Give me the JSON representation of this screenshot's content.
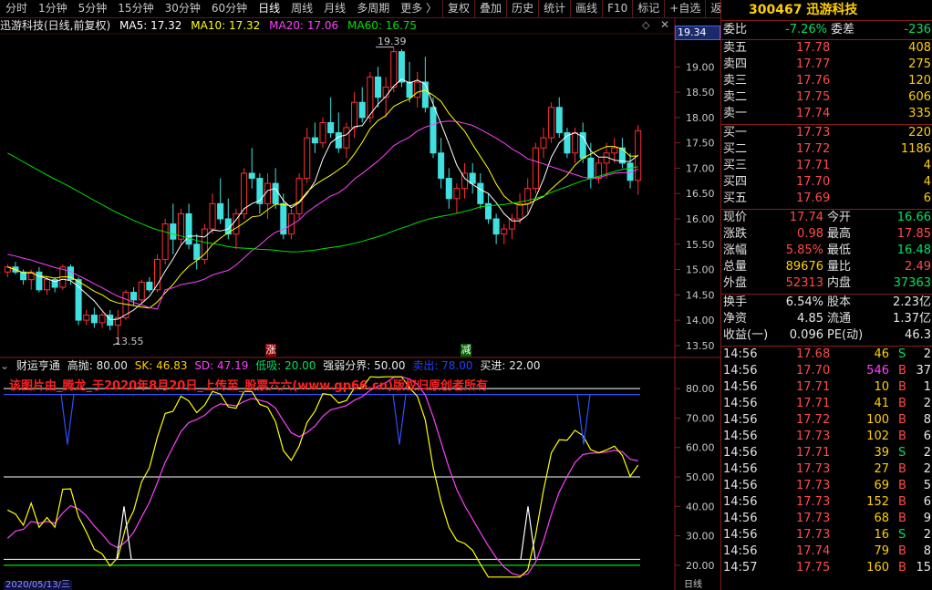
{
  "toolbar": {
    "items": [
      "分时",
      "1分钟",
      "5分钟",
      "15分钟",
      "30分钟",
      "60分钟",
      "日线",
      "周线",
      "月线",
      "多周期",
      "更多 〉"
    ],
    "active": "日线",
    "right_items": [
      "复权",
      "叠加",
      "历史",
      "统计",
      "画线",
      "F10",
      "标记",
      "+自选",
      "返回"
    ]
  },
  "chart_header": {
    "title": "迅游科技(日线,前复权)",
    "ma5": "MA5: 17.32",
    "ma10": "MA10: 17.32",
    "ma20": "MA20: 17.06",
    "ma60": "MA60: 16.75",
    "colors": {
      "ma5": "#ffffff",
      "ma10": "#ffff00",
      "ma20": "#ff40ff",
      "ma60": "#00e000"
    }
  },
  "price_chart": {
    "high_label": "19.39",
    "low_label": "13.55",
    "current_tag": "19.34",
    "y_ticks": [
      "19.00",
      "18.50",
      "18.00",
      "17.50",
      "17.00",
      "16.50",
      "16.00",
      "15.50",
      "15.00",
      "14.50",
      "14.00",
      "13.50"
    ],
    "y_values": [
      19.0,
      18.5,
      18.0,
      17.5,
      17.0,
      16.5,
      16.0,
      15.5,
      15.0,
      14.5,
      14.0,
      13.5
    ],
    "signal_zhang": "涨",
    "signal_jian": "减"
  },
  "indicator": {
    "name": "财运亨通",
    "high_throw": "高抛: 80.00",
    "sk": "SK: 46.83",
    "sd": "SD: 47.19",
    "low_buy": "低吸: 20.00",
    "strong_weak": "强弱分界: 50.00",
    "sell": "卖出: 78.00",
    "buy": "买进: 22.00",
    "watermark": "该图片由_腾龙_于2020年8月20日_上传至_股票六六(www.gp66.cn)版权归原创者所有",
    "y_ticks": [
      "80.00",
      "70.00",
      "60.00",
      "50.00",
      "40.00",
      "30.00",
      "20.00"
    ],
    "y_values": [
      80,
      70,
      60,
      50,
      40,
      30,
      20
    ]
  },
  "footer": {
    "date": "2020/05/13/三",
    "axis_label": "日线"
  },
  "quote": {
    "code": "300467",
    "name": "迅游科技",
    "weibi_label": "委比",
    "weibi": "-7.26%",
    "weicha_label": "委差",
    "weicha": "-236",
    "asks": [
      {
        "label": "卖五",
        "price": "17.78",
        "vol": "408"
      },
      {
        "label": "卖四",
        "price": "17.77",
        "vol": "275"
      },
      {
        "label": "卖三",
        "price": "17.76",
        "vol": "120"
      },
      {
        "label": "卖二",
        "price": "17.75",
        "vol": "606"
      },
      {
        "label": "卖一",
        "price": "17.74",
        "vol": "335"
      }
    ],
    "bids": [
      {
        "label": "买一",
        "price": "17.73",
        "vol": "220"
      },
      {
        "label": "买二",
        "price": "17.72",
        "vol": "1186"
      },
      {
        "label": "买三",
        "price": "17.71",
        "vol": "4"
      },
      {
        "label": "买四",
        "price": "17.70",
        "vol": "4"
      },
      {
        "label": "买五",
        "price": "17.69",
        "vol": "6"
      }
    ],
    "stats": [
      {
        "l1": "现价",
        "v1": "17.74",
        "c1": "red",
        "l2": "今开",
        "v2": "16.66",
        "c2": "green"
      },
      {
        "l1": "涨跌",
        "v1": "0.98",
        "c1": "red",
        "l2": "最高",
        "v2": "17.85",
        "c2": "red"
      },
      {
        "l1": "涨幅",
        "v1": "5.85%",
        "c1": "red",
        "l2": "最低",
        "v2": "16.48",
        "c2": "green"
      },
      {
        "l1": "总量",
        "v1": "89676",
        "c1": "yellow",
        "l2": "量比",
        "v2": "2.49",
        "c2": "red"
      },
      {
        "l1": "外盘",
        "v1": "52313",
        "c1": "red",
        "l2": "内盘",
        "v2": "37363",
        "c2": "green"
      }
    ],
    "finance": [
      {
        "l1": "换手",
        "v1": "6.54%",
        "l2": "股本",
        "v2": "2.23亿"
      },
      {
        "l1": "净资",
        "v1": "4.85",
        "l2": "流通",
        "v2": "1.37亿"
      },
      {
        "l1": "收益(一)",
        "v1": "0.096",
        "l2": "PE(动)",
        "v2": "46.3"
      }
    ],
    "ticks": [
      {
        "time": "14:56",
        "price": "17.68",
        "vol": "46",
        "side": "S",
        "n": "2"
      },
      {
        "time": "14:56",
        "price": "17.70",
        "vol": "546",
        "side": "B",
        "n": "37"
      },
      {
        "time": "14:56",
        "price": "17.71",
        "vol": "10",
        "side": "B",
        "n": "1"
      },
      {
        "time": "14:56",
        "price": "17.71",
        "vol": "41",
        "side": "B",
        "n": "2"
      },
      {
        "time": "14:56",
        "price": "17.72",
        "vol": "100",
        "side": "B",
        "n": "8"
      },
      {
        "time": "14:56",
        "price": "17.73",
        "vol": "102",
        "side": "B",
        "n": "6"
      },
      {
        "time": "14:56",
        "price": "17.71",
        "vol": "39",
        "side": "S",
        "n": "2"
      },
      {
        "time": "14:56",
        "price": "17.73",
        "vol": "27",
        "side": "B",
        "n": "2"
      },
      {
        "time": "14:56",
        "price": "17.73",
        "vol": "69",
        "side": "B",
        "n": "5"
      },
      {
        "time": "14:56",
        "price": "17.73",
        "vol": "152",
        "side": "B",
        "n": "6"
      },
      {
        "time": "14:56",
        "price": "17.73",
        "vol": "68",
        "side": "B",
        "n": "9"
      },
      {
        "time": "14:56",
        "price": "17.73",
        "vol": "16",
        "side": "S",
        "n": "2"
      },
      {
        "time": "14:56",
        "price": "17.74",
        "vol": "79",
        "side": "B",
        "n": "8"
      },
      {
        "time": "14:57",
        "price": "17.75",
        "vol": "160",
        "side": "B",
        "n": "15"
      }
    ]
  },
  "chart_data": {
    "type": "candlestick",
    "ohlc": [
      [
        14.95,
        15.1,
        14.85,
        15.05
      ],
      [
        15.05,
        15.15,
        14.9,
        14.95
      ],
      [
        14.95,
        15.0,
        14.7,
        14.8
      ],
      [
        14.8,
        15.0,
        14.6,
        14.95
      ],
      [
        14.95,
        15.05,
        14.55,
        14.6
      ],
      [
        14.6,
        14.85,
        14.5,
        14.8
      ],
      [
        14.8,
        14.85,
        14.55,
        14.65
      ],
      [
        14.65,
        15.1,
        14.6,
        15.05
      ],
      [
        15.05,
        15.1,
        14.7,
        14.8
      ],
      [
        14.8,
        14.85,
        13.9,
        14.0
      ],
      [
        14.0,
        14.2,
        13.9,
        14.1
      ],
      [
        14.1,
        14.25,
        13.85,
        13.95
      ],
      [
        13.95,
        14.15,
        13.85,
        14.1
      ],
      [
        14.1,
        14.2,
        13.8,
        13.9
      ],
      [
        13.9,
        14.2,
        13.55,
        14.05
      ],
      [
        14.05,
        14.6,
        14.0,
        14.55
      ],
      [
        14.55,
        14.65,
        14.3,
        14.4
      ],
      [
        14.4,
        14.8,
        14.35,
        14.75
      ],
      [
        14.75,
        14.85,
        14.55,
        14.6
      ],
      [
        14.6,
        15.3,
        14.55,
        15.2
      ],
      [
        15.2,
        16.0,
        15.1,
        15.9
      ],
      [
        15.9,
        16.3,
        15.3,
        15.6
      ],
      [
        15.6,
        16.2,
        15.5,
        16.1
      ],
      [
        16.1,
        16.3,
        15.4,
        15.5
      ],
      [
        15.5,
        15.7,
        15.0,
        15.2
      ],
      [
        15.2,
        15.9,
        15.1,
        15.8
      ],
      [
        15.8,
        16.5,
        15.7,
        16.3
      ],
      [
        16.3,
        16.8,
        15.9,
        16.0
      ],
      [
        16.0,
        16.4,
        15.6,
        15.7
      ],
      [
        15.7,
        16.2,
        15.4,
        16.1
      ],
      [
        16.1,
        17.0,
        16.0,
        16.9
      ],
      [
        16.9,
        17.4,
        16.6,
        16.8
      ],
      [
        16.8,
        16.9,
        16.1,
        16.3
      ],
      [
        16.3,
        16.9,
        16.0,
        16.7
      ],
      [
        16.7,
        17.0,
        16.2,
        16.3
      ],
      [
        16.3,
        16.5,
        15.6,
        15.7
      ],
      [
        15.7,
        16.2,
        15.6,
        16.1
      ],
      [
        16.1,
        16.9,
        16.0,
        16.8
      ],
      [
        16.8,
        17.8,
        16.7,
        17.6
      ],
      [
        17.6,
        17.9,
        17.3,
        17.5
      ],
      [
        17.5,
        18.0,
        17.4,
        17.9
      ],
      [
        17.9,
        18.4,
        17.6,
        17.7
      ],
      [
        17.7,
        18.1,
        17.3,
        17.4
      ],
      [
        17.4,
        17.9,
        17.2,
        17.8
      ],
      [
        17.8,
        18.5,
        17.6,
        18.3
      ],
      [
        18.3,
        18.6,
        17.9,
        18.0
      ],
      [
        18.0,
        18.9,
        17.9,
        18.8
      ],
      [
        18.8,
        19.0,
        18.2,
        18.4
      ],
      [
        18.4,
        18.8,
        18.0,
        18.6
      ],
      [
        18.6,
        19.39,
        18.5,
        19.3
      ],
      [
        19.3,
        19.35,
        18.6,
        18.7
      ],
      [
        18.7,
        19.1,
        18.3,
        18.4
      ],
      [
        18.4,
        18.9,
        18.2,
        18.7
      ],
      [
        18.7,
        19.2,
        18.1,
        18.2
      ],
      [
        18.2,
        18.4,
        17.2,
        17.3
      ],
      [
        17.3,
        17.6,
        16.6,
        16.8
      ],
      [
        16.8,
        17.0,
        16.2,
        16.4
      ],
      [
        16.4,
        16.7,
        16.1,
        16.6
      ],
      [
        16.6,
        17.1,
        16.4,
        16.9
      ],
      [
        16.9,
        17.1,
        16.5,
        16.7
      ],
      [
        16.7,
        16.9,
        16.2,
        16.3
      ],
      [
        16.3,
        16.5,
        15.9,
        16.0
      ],
      [
        16.0,
        16.1,
        15.5,
        15.7
      ],
      [
        15.7,
        15.9,
        15.5,
        15.8
      ],
      [
        15.8,
        16.1,
        15.6,
        16.0
      ],
      [
        16.0,
        16.5,
        15.9,
        16.3
      ],
      [
        16.3,
        16.8,
        16.1,
        16.6
      ],
      [
        16.6,
        17.5,
        16.5,
        17.4
      ],
      [
        17.4,
        17.8,
        17.2,
        17.6
      ],
      [
        17.6,
        18.3,
        17.5,
        18.2
      ],
      [
        18.2,
        18.4,
        17.6,
        17.7
      ],
      [
        17.7,
        17.8,
        17.2,
        17.3
      ],
      [
        17.3,
        17.8,
        17.1,
        17.7
      ],
      [
        17.7,
        17.9,
        17.1,
        17.2
      ],
      [
        17.2,
        17.5,
        16.6,
        16.8
      ],
      [
        16.8,
        17.2,
        16.7,
        17.1
      ],
      [
        17.1,
        17.5,
        16.8,
        17.3
      ],
      [
        17.3,
        17.6,
        17.1,
        17.4
      ],
      [
        17.4,
        17.6,
        17.0,
        17.1
      ],
      [
        17.1,
        17.3,
        16.6,
        16.76
      ],
      [
        16.76,
        17.85,
        16.48,
        17.74
      ]
    ],
    "ma60_hint": "smooth"
  }
}
